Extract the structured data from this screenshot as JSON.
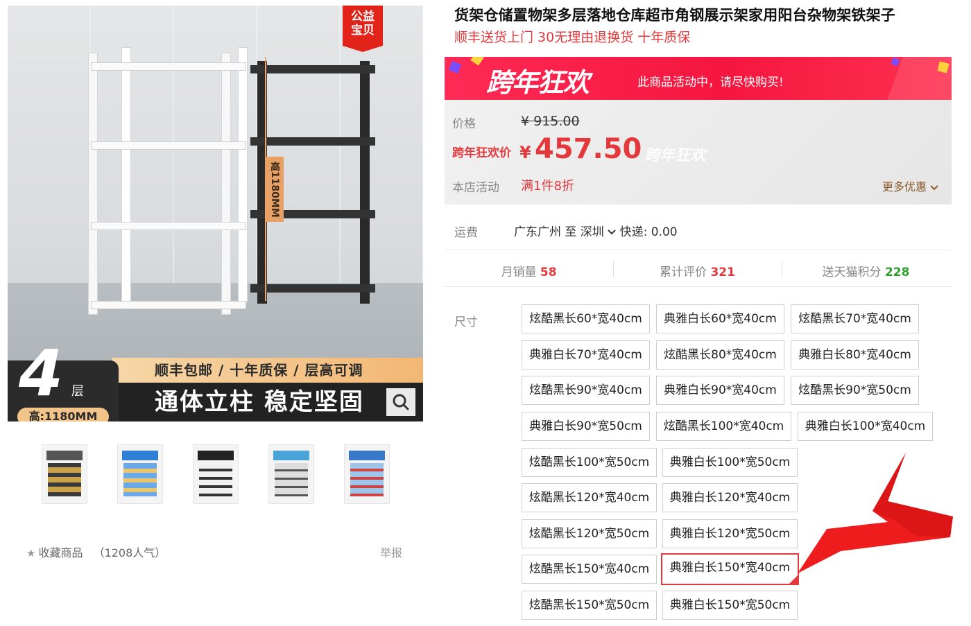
{
  "product": {
    "title": "货架仓储置物架多层落地仓库超市角钢展示架家用阳台杂物架铁架子",
    "subtitle": "顺丰送货上门 30无理由退换货 十年质保"
  },
  "main_image": {
    "badge": [
      "公益",
      "宝贝"
    ],
    "height_tag": "高1180MM",
    "layer_number": "4",
    "layer_char": "层",
    "height_pill": "高:1180MM",
    "band_top": "顺丰包邮 / 十年质保 / 层高可调",
    "band_main": "通体立柱  稳定坚固"
  },
  "thumbnails": [
    {
      "name": "thumb-1",
      "colors": [
        "#3a3a3a",
        "#c9a24a"
      ]
    },
    {
      "name": "thumb-2",
      "colors": [
        "#2f7fd6",
        "#6aa8e8"
      ]
    },
    {
      "name": "thumb-3",
      "colors": [
        "#222222",
        "#f0f0f0"
      ]
    },
    {
      "name": "thumb-4",
      "colors": [
        "#4aa4d8",
        "#dddddd"
      ]
    },
    {
      "name": "thumb-5",
      "colors": [
        "#3a78c8",
        "#9fc4ea"
      ]
    }
  ],
  "favorite": {
    "label": "收藏商品",
    "count": "（1208人气）"
  },
  "report": "举报",
  "promo": {
    "name": "跨年狂欢",
    "message": "此商品活动中，请尽快购买!"
  },
  "price": {
    "label": "价格",
    "original": "¥ 915.00",
    "promo_label": "跨年狂欢价",
    "currency": "¥",
    "value": "457.50",
    "ghost": "跨年狂欢",
    "shop_label": "本店活动",
    "shop_promo": "满1件8折",
    "more": "更多优惠"
  },
  "shipping": {
    "label": "运费",
    "text": "广东广州  至 深圳",
    "text2": " 快递: 0.00"
  },
  "stats": {
    "monthly_label": "月销量",
    "monthly_value": "58",
    "reviews_label": "累计评价",
    "reviews_value": "321",
    "points_label": "送天猫积分",
    "points_value": "228"
  },
  "size": {
    "label": "尺寸",
    "options": [
      "炫酷黑长60*宽40cm",
      "典雅白长60*宽40cm",
      "炫酷黑长70*宽40cm",
      "典雅白长70*宽40cm",
      "炫酷黑长80*宽40cm",
      "典雅白长80*宽40cm",
      "炫酷黑长90*宽40cm",
      "典雅白长90*宽40cm",
      "炫酷黑长90*宽50cm",
      "典雅白长90*宽50cm",
      "炫酷黑长100*宽40cm",
      "典雅白长100*宽40cm",
      "炫酷黑长100*宽50cm",
      "典雅白长100*宽50cm",
      "炫酷黑长120*宽40cm",
      "典雅白长120*宽40cm",
      "炫酷黑长120*宽50cm",
      "典雅白长120*宽50cm",
      "炫酷黑长150*宽40cm",
      "典雅白长150*宽40cm",
      "炫酷黑长150*宽50cm",
      "典雅白长150*宽50cm"
    ],
    "selected": "典雅白长150*宽40cm"
  },
  "colors": {
    "accent": "#e4393c",
    "promo_bg": "#f5163f",
    "points": "#2e9e2e"
  }
}
